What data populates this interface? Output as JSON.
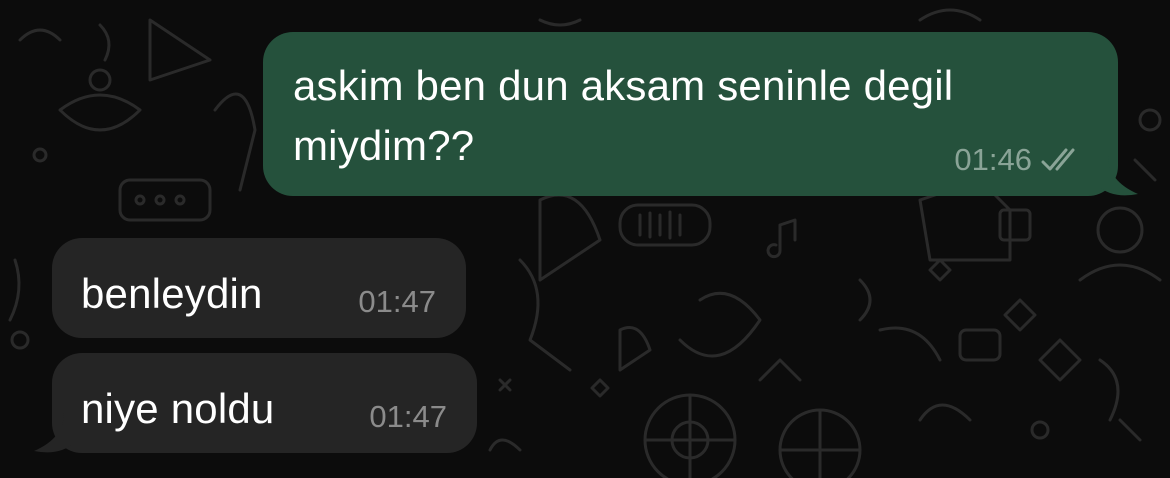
{
  "messages": [
    {
      "direction": "outgoing",
      "text": "askim ben dun aksam seninle degil miydim??",
      "time": "01:46",
      "status_icon": "double-check-icon"
    },
    {
      "direction": "incoming",
      "text": "benleydin",
      "time": "01:47"
    },
    {
      "direction": "incoming",
      "text": "niye noldu",
      "time": "01:47"
    }
  ],
  "colors": {
    "background": "#0c0c0c",
    "outgoing_bubble": "#25513c",
    "incoming_bubble": "#252525",
    "text": "#ffffff",
    "timestamp": "#8b8b8b"
  }
}
